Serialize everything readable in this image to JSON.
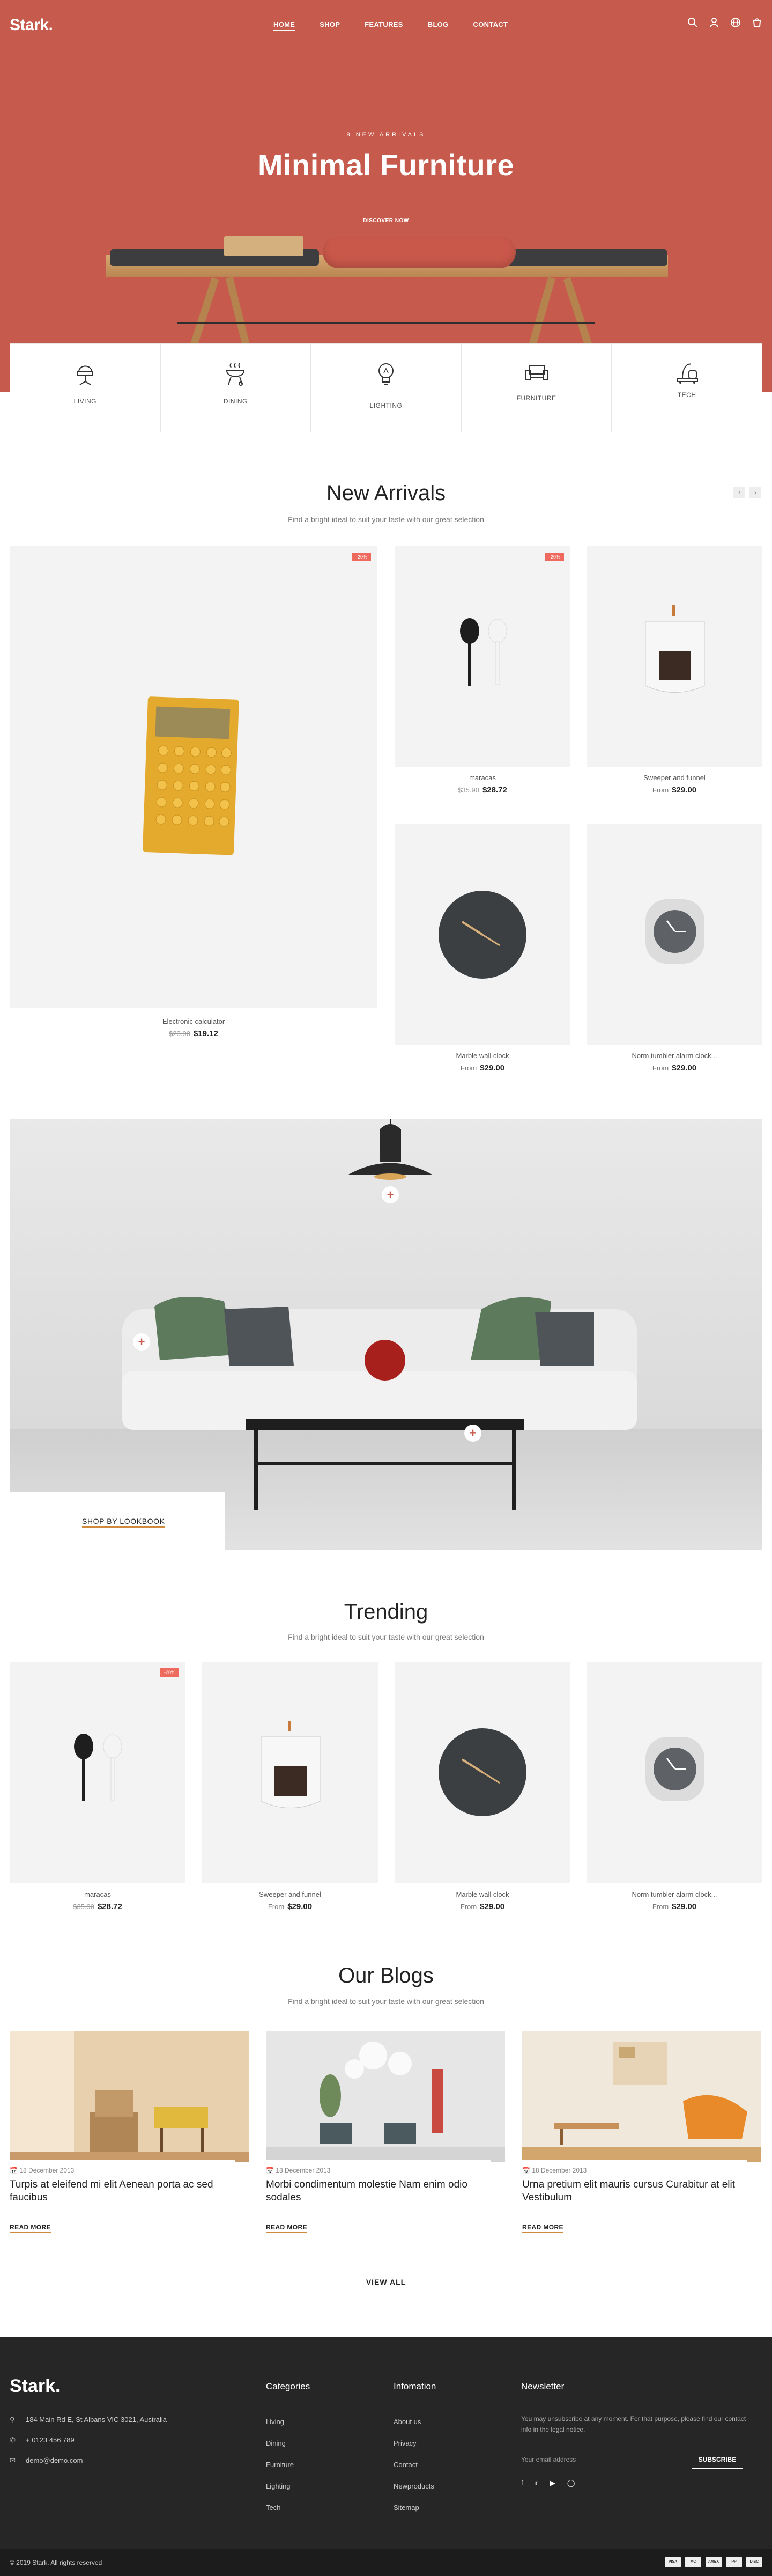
{
  "header": {
    "logo": "Stark",
    "nav": [
      "HOME",
      "SHOP",
      "FEATURES",
      "BLOG",
      "CONTACT"
    ],
    "icons": [
      "search-icon",
      "user-icon",
      "globe-icon",
      "cart-icon"
    ],
    "cart_count": "0"
  },
  "hero": {
    "subtitle": "8 NEW ARRIVALS",
    "title": "Minimal Furniture",
    "button": "DISCOVER NOW",
    "bg_color": "#c65a4c"
  },
  "categories": [
    {
      "label": "LIVING",
      "icon": "chair-icon"
    },
    {
      "label": "DINING",
      "icon": "grill-icon"
    },
    {
      "label": "LIGHTING",
      "icon": "bulb-icon"
    },
    {
      "label": "FURNITURE",
      "icon": "sofa-icon"
    },
    {
      "label": "TECH",
      "icon": "vacuum-icon"
    }
  ],
  "new_arrivals": {
    "title": "New Arrivals",
    "subtitle": "Find a bright ideal to suit your taste with our great selection",
    "products": [
      {
        "name": "Electronic calculator",
        "old_price": "$23.90",
        "price": "$19.12",
        "badge": "-20%"
      },
      {
        "name": "maracas",
        "old_price": "$35.90",
        "price": "$28.72",
        "badge": "-20%"
      },
      {
        "name": "Sweeper and funnel",
        "prefix": "From",
        "price": "$29.00"
      },
      {
        "name": "Marble wall clock",
        "prefix": "From",
        "price": "$29.00"
      },
      {
        "name": "Norm tumbler alarm clock...",
        "prefix": "From",
        "price": "$29.00"
      }
    ]
  },
  "lookbook": {
    "button": "SHOP BY LOOKBOOK"
  },
  "trending": {
    "title": "Trending",
    "subtitle": "Find a bright ideal to suit your taste with our great selection",
    "products": [
      {
        "name": "maracas",
        "old_price": "$35.90",
        "price": "$28.72",
        "badge": "-20%"
      },
      {
        "name": "Sweeper and funnel",
        "prefix": "From",
        "price": "$29.00"
      },
      {
        "name": "Marble wall clock",
        "prefix": "From",
        "price": "$29.00"
      },
      {
        "name": "Norm tumbler alarm clock...",
        "prefix": "From",
        "price": "$29.00"
      }
    ]
  },
  "blogs": {
    "title": "Our Blogs",
    "subtitle": "Find a bright ideal to suit your taste with our great selection",
    "posts": [
      {
        "date": "18 December 2013",
        "title": "Turpis at eleifend mi elit Aenean porta ac sed faucibus",
        "more": "READ MORE"
      },
      {
        "date": "18 December 2013",
        "title": "Morbi condimentum molestie Nam enim odio sodales",
        "more": "READ MORE"
      },
      {
        "date": "18 December 2013",
        "title": "Urna pretium elit mauris cursus Curabitur at elit Vestibulum",
        "more": "READ MORE"
      }
    ],
    "view_all": "VIEW ALL"
  },
  "footer": {
    "logo": "Stark.",
    "address": "184 Main Rd E, St Albans VIC 3021, Australia",
    "phone": "+ 0123 456 789",
    "email": "demo@demo.com",
    "categories_title": "Categories",
    "categories": [
      "Living",
      "Dining",
      "Furniture",
      "Lighting",
      "Tech"
    ],
    "information_title": "Infomation",
    "information": [
      "About us",
      "Privacy",
      "Contact",
      "Newproducts",
      "Sitemap"
    ],
    "newsletter_title": "Newsletter",
    "newsletter_text": "You may unsubscribe at any moment. For that purpose, please find our contact info in the legal notice.",
    "email_placeholder": "Your email address",
    "subscribe": "SUBSCRIBE",
    "social": [
      "facebook-icon",
      "twitter-icon",
      "youtube-icon",
      "instagram-icon"
    ],
    "copyright": "© 2019 Stark. All rights reserved",
    "payments": [
      "VISA",
      "MC",
      "AMEX",
      "PP",
      "DISC"
    ]
  }
}
